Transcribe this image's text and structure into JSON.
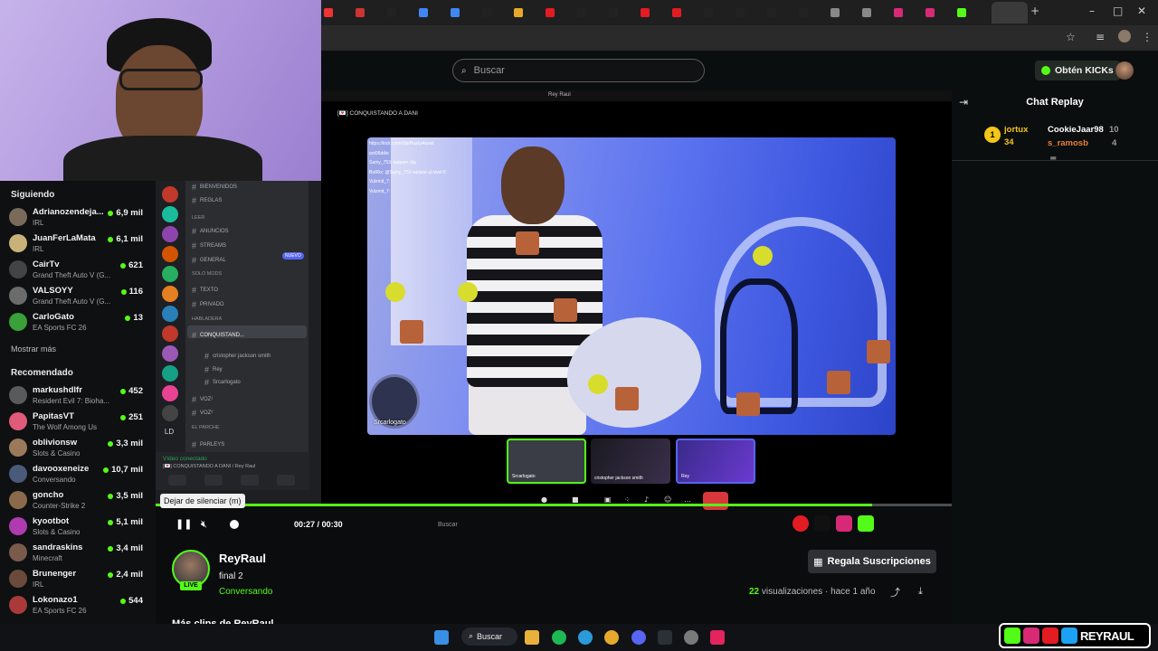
{
  "search": {
    "placeholder": "Buscar"
  },
  "header": {
    "kicks_label": "Obtén KICKs"
  },
  "sidebar": {
    "following_title": "Siguiendo",
    "following": [
      {
        "name": "Adrianozendeja...",
        "category": "IRL",
        "viewers": "6,9 mil",
        "color": "#7a6a5a"
      },
      {
        "name": "JuanFerLaMata",
        "category": "IRL",
        "viewers": "6,1 mil",
        "color": "#c9b27a"
      },
      {
        "name": "CairTv",
        "category": "Grand Theft Auto V (G...",
        "viewers": "621",
        "color": "#444"
      },
      {
        "name": "VALSOYY",
        "category": "Grand Theft Auto V (G...",
        "viewers": "116",
        "color": "#6b6b6b"
      },
      {
        "name": "CarloGato",
        "category": "EA Sports FC 26",
        "viewers": "13",
        "color": "#3aa03a"
      }
    ],
    "show_more": "Mostrar más",
    "recommended_title": "Recomendado",
    "recommended": [
      {
        "name": "markushdlfr",
        "category": "Resident Evil 7: Bioha...",
        "viewers": "452",
        "color": "#5a5a5a"
      },
      {
        "name": "PapitasVT",
        "category": "The Wolf Among Us",
        "viewers": "251",
        "color": "#e05a7a"
      },
      {
        "name": "oblivionsw",
        "category": "Slots & Casino",
        "viewers": "3,3 mil",
        "color": "#9a7a5a"
      },
      {
        "name": "davooxeneize",
        "category": "Conversando",
        "viewers": "10,7 mil",
        "color": "#4a5a7a"
      },
      {
        "name": "goncho",
        "category": "Counter-Strike 2",
        "viewers": "3,5 mil",
        "color": "#8a6a4a"
      },
      {
        "name": "kyootbot",
        "category": "Slots & Casino",
        "viewers": "5,1 mil",
        "color": "#b03ab0"
      },
      {
        "name": "sandraskins",
        "category": "Minecraft",
        "viewers": "3,4 mil",
        "color": "#7a5a4a"
      },
      {
        "name": "Brunenger",
        "category": "IRL",
        "viewers": "2,4 mil",
        "color": "#6a4a3a"
      },
      {
        "name": "Lokonazo1",
        "category": "EA Sports FC 26",
        "viewers": "544",
        "color": "#aa3a3a"
      }
    ]
  },
  "discord": {
    "server_short": "LD",
    "channels": [
      "BIENVENIDOS",
      "REGLAS",
      "ANUNCIOS",
      "STREAMS",
      "GENERAL",
      "TEXTO",
      "PRIVADO",
      "CONQUISTAND...",
      "cristopher jackson smith",
      "Rey",
      "Srcarlogato",
      "VOZ¹",
      "VOZ²",
      "PARLEYS"
    ],
    "categories": [
      "LEER",
      "SOLO MODS",
      "HABLADERA",
      "EL PARCHE"
    ],
    "new_badge": "NUEVO",
    "status_title": "Vídeo conectado",
    "status_sub": "[💌] CONQUISTANDO A DANI / Rey Raul"
  },
  "stream": {
    "window_title": "Rey Raul",
    "voice_channel": "[💌] CONQUISTANDO A DANI",
    "cam_label": "Srcarlogato",
    "overlay_url": "https://kick.com/clip/Husky4usist",
    "overlay_chat": [
      "ant96ddie",
      "Samy_753: saquen clip",
      "BotRix: @Samy_753 subiste al nivel 6",
      "Vulzmit_7:",
      "Vulzmit_7:"
    ],
    "participants": [
      "Srcarlogato",
      "cristopher jackson smith",
      "Rey"
    ]
  },
  "player": {
    "tooltip": "Dejar de silenciar (m)",
    "time_current": "00:27",
    "time_sep": "/",
    "time_total": "00:30",
    "progress": 0.9,
    "mini_search": "Buscar"
  },
  "clip": {
    "streamer": "ReyRaul",
    "title": "final 2",
    "category": "Conversando",
    "live": "LIVE",
    "views_count": "22",
    "views_label": "visualizaciones",
    "ago": "hace 1 año",
    "gift_label": "Regala Suscripciones",
    "more_clips": "Más clips de ReyRaul"
  },
  "chat": {
    "title": "Chat Replay",
    "leaderboard": [
      {
        "rank": "1",
        "user": "jortux",
        "count": "34"
      },
      {
        "user": "CookieJaar98",
        "count": "10"
      },
      {
        "user": "s_ramosb",
        "count": "4"
      }
    ]
  },
  "taskbar": {
    "search_label": "Buscar"
  },
  "brand": {
    "text": "REYRAUL"
  },
  "colors": {
    "kick_green": "#53fc18",
    "live_red": "#da373c",
    "discord_blurple": "#5865f2"
  }
}
